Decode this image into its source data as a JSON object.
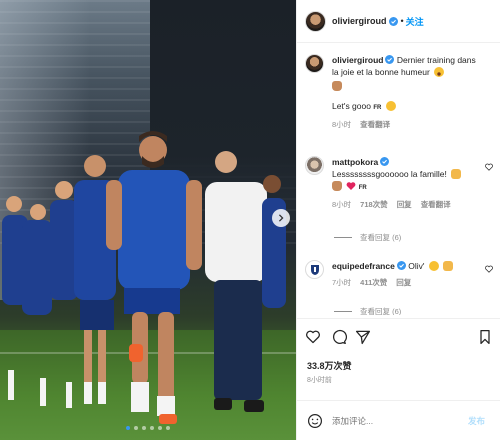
{
  "post": {
    "username": "oliviergiroud",
    "follow_label": "关注",
    "more_label": "···"
  },
  "caption": {
    "username": "oliviergiroud",
    "text": "Dernier training dans la joie et la bonne humeur",
    "line2": "Let's gooo",
    "fr_tag": "FR",
    "time": "8小时",
    "translate": "查看翻译"
  },
  "comments": [
    {
      "username": "mattpokora",
      "text": "Lessssssssgoooooo la famille!",
      "fr_tag": "FR",
      "time": "8小时",
      "likes": "718次赞",
      "reply": "回复",
      "translate": "查看翻译",
      "view_replies": "查看回复 (6)"
    },
    {
      "username": "equipedefrance",
      "text": "Oliv'",
      "time": "7小时",
      "likes": "411次赞",
      "reply": "回复",
      "view_replies": "查看回复 (6)"
    }
  ],
  "actions": {
    "like_count": "33.8万次赞",
    "post_time": "8小时前"
  },
  "add_comment": {
    "placeholder": "添加评论...",
    "post_label": "发布"
  },
  "carousel": {
    "slide_count": 6,
    "active_index": 0
  },
  "colors": {
    "link": "#0095f6",
    "verified": "#3897f0",
    "jersey": "#1f3f8f",
    "pitch": "#4f8530"
  }
}
